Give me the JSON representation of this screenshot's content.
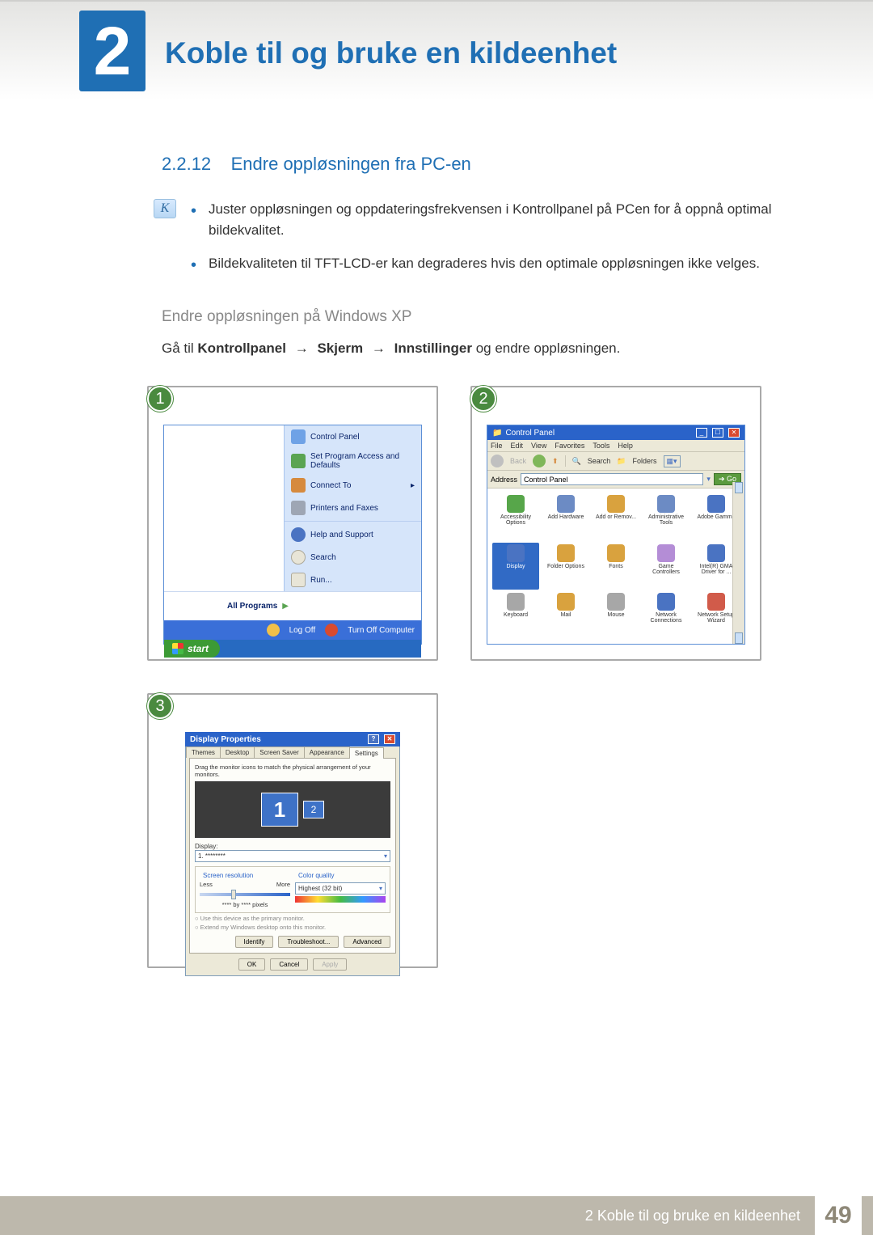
{
  "chapter": {
    "number": "2",
    "title": "Koble til og bruke en kildeenhet"
  },
  "section": {
    "number": "2.2.12",
    "title": "Endre oppløsningen fra PC-en"
  },
  "note_bullets": [
    "Juster oppløsningen og oppdateringsfrekvensen i Kontrollpanel på PCen for å oppnå optimal bildekvalitet.",
    "Bildekvaliteten til TFT-LCD-er kan degraderes hvis den optimale oppløsningen ikke velges."
  ],
  "sub_heading": "Endre oppløsningen på Windows XP",
  "instruction": {
    "prefix": "Gå til ",
    "path": [
      "Kontrollpanel",
      "Skjerm",
      "Innstillinger"
    ],
    "suffix": " og endre oppløsningen.",
    "arrow": "→"
  },
  "steps": {
    "s1": "1",
    "s2": "2",
    "s3": "3"
  },
  "start_menu": {
    "items": [
      "Control Panel",
      "Set Program Access and Defaults",
      "Connect To",
      "Printers and Faxes",
      "Help and Support",
      "Search",
      "Run..."
    ],
    "all_programs": "All Programs",
    "log_off": "Log Off",
    "turn_off": "Turn Off Computer",
    "start": "start"
  },
  "control_panel": {
    "title": "Control Panel",
    "menus": [
      "File",
      "Edit",
      "View",
      "Favorites",
      "Tools",
      "Help"
    ],
    "toolbar": {
      "back": "Back",
      "search": "Search",
      "folders": "Folders"
    },
    "address_label": "Address",
    "address_value": "Control Panel",
    "go": "Go",
    "items": [
      {
        "label": "Accessibility Options",
        "c": "#57a64a"
      },
      {
        "label": "Add Hardware",
        "c": "#6c8bc4"
      },
      {
        "label": "Add or Remov...",
        "c": "#d9a23e"
      },
      {
        "label": "Administrative Tools",
        "c": "#6c8bc4"
      },
      {
        "label": "Adobe Gamma",
        "c": "#4a73c2"
      },
      {
        "label": "Display",
        "c": "#4a73c2",
        "selected": true
      },
      {
        "label": "Folder Options",
        "c": "#d9a23e"
      },
      {
        "label": "Fonts",
        "c": "#d9a23e"
      },
      {
        "label": "Game Controllers",
        "c": "#b48dd6"
      },
      {
        "label": "Intel(R) GMA Driver for ...",
        "c": "#4a73c2"
      },
      {
        "label": "Keyboard",
        "c": "#a7a7a7"
      },
      {
        "label": "Mail",
        "c": "#d9a23e"
      },
      {
        "label": "Mouse",
        "c": "#a7a7a7"
      },
      {
        "label": "Network Connections",
        "c": "#4a73c2"
      },
      {
        "label": "Network Setup Wizard",
        "c": "#d15b4a"
      }
    ]
  },
  "display_props": {
    "title": "Display Properties",
    "tabs": [
      "Themes",
      "Desktop",
      "Screen Saver",
      "Appearance",
      "Settings"
    ],
    "active_tab": "Settings",
    "hint": "Drag the monitor icons to match the physical arrangement of your monitors.",
    "mon1": "1",
    "mon2": "2",
    "display_label": "Display:",
    "display_value": "1. ********",
    "screen_res_label": "Screen resolution",
    "less": "Less",
    "more": "More",
    "res_text": "**** by **** pixels",
    "color_quality_label": "Color quality",
    "color_quality_value": "Highest (32 bit)",
    "chk1": "Use this device as the primary monitor.",
    "chk2": "Extend my Windows desktop onto this monitor.",
    "identify": "Identify",
    "troubleshoot": "Troubleshoot...",
    "advanced": "Advanced",
    "ok": "OK",
    "cancel": "Cancel",
    "apply": "Apply"
  },
  "footer": {
    "text_prefix": "2 ",
    "text": "Koble til og bruke en kildeenhet",
    "page": "49"
  }
}
